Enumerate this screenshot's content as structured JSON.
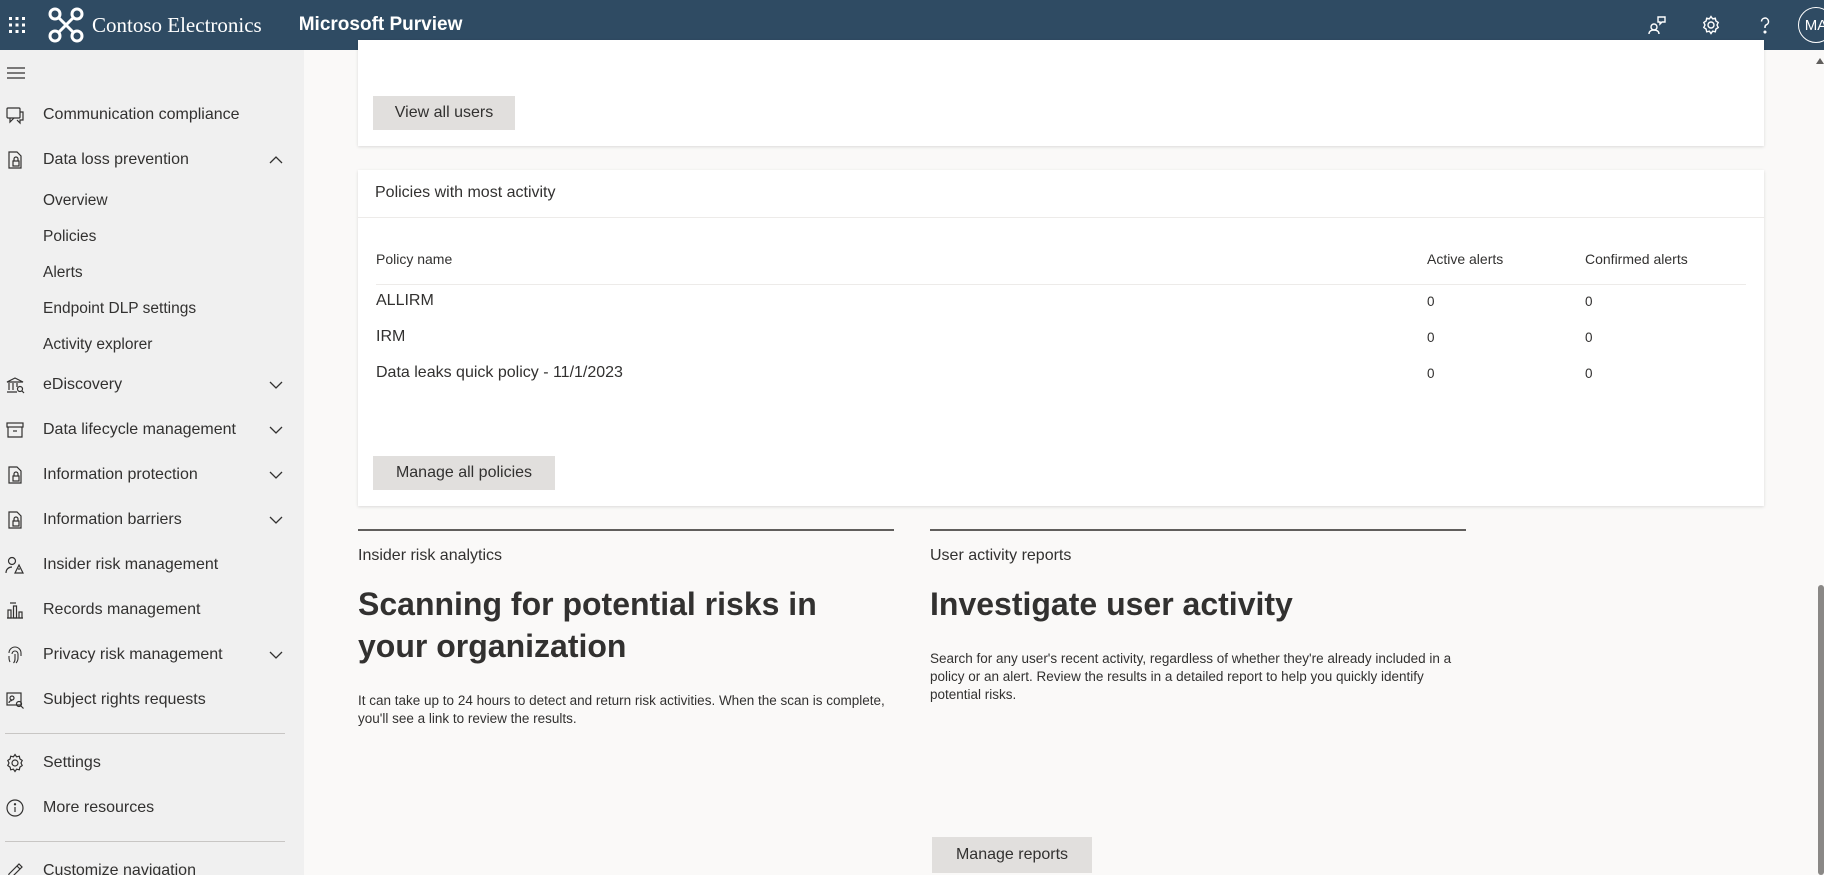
{
  "topbar": {
    "brand": "Contoso Electronics",
    "app": "Microsoft Purview",
    "avatar": "MA",
    "icons": [
      "waffle-icon",
      "contoso-logo-icon",
      "people-chat-icon",
      "settings-gear-icon",
      "help-icon"
    ]
  },
  "sidebar": {
    "items": [
      {
        "label": "Communication compliance",
        "icon": "chat-compliance-icon"
      },
      {
        "label": "Data loss prevention",
        "icon": "dlp-icon",
        "expanded": true
      },
      {
        "label": "eDiscovery",
        "icon": "bank-icon"
      },
      {
        "label": "Data lifecycle management",
        "icon": "archive-icon"
      },
      {
        "label": "Information protection",
        "icon": "lock-doc-icon"
      },
      {
        "label": "Information barriers",
        "icon": "lock-doc-icon"
      },
      {
        "label": "Insider risk management",
        "icon": "person-warning-icon"
      },
      {
        "label": "Records management",
        "icon": "chart-doc-icon"
      },
      {
        "label": "Privacy risk management",
        "icon": "fingerprint-icon"
      },
      {
        "label": "Subject rights requests",
        "icon": "person-search-icon"
      },
      {
        "label": "Settings",
        "icon": "gear-icon"
      },
      {
        "label": "More resources",
        "icon": "info-icon"
      },
      {
        "label": "Customize navigation",
        "icon": "pencil-icon"
      }
    ],
    "dlp_sub": [
      "Overview",
      "Policies",
      "Alerts",
      "Endpoint DLP settings",
      "Activity explorer"
    ]
  },
  "main": {
    "view_all_users": "View all users",
    "policies_card": {
      "title": "Policies with most activity",
      "columns": [
        "Policy name",
        "Active alerts",
        "Confirmed alerts"
      ],
      "rows": [
        {
          "name": "ALLIRM",
          "active": "0",
          "confirmed": "0"
        },
        {
          "name": "IRM",
          "active": "0",
          "confirmed": "0"
        },
        {
          "name": "Data leaks quick policy - 11/1/2023",
          "active": "0",
          "confirmed": "0"
        }
      ],
      "button": "Manage all policies"
    },
    "insider": {
      "eyebrow": "Insider risk analytics",
      "headline": "Scanning for potential risks in your organization",
      "desc": "It can take up to 24 hours to detect and return risk activities. When the scan is complete, you'll see a link to review the results."
    },
    "user_activity": {
      "eyebrow": "User activity reports",
      "headline": "Investigate user activity",
      "desc": "Search for any user's recent activity, regardless of whether they're already included in a policy or an alert. Review the results in a detailed report to help you quickly identify potential risks.",
      "button": "Manage reports"
    }
  }
}
